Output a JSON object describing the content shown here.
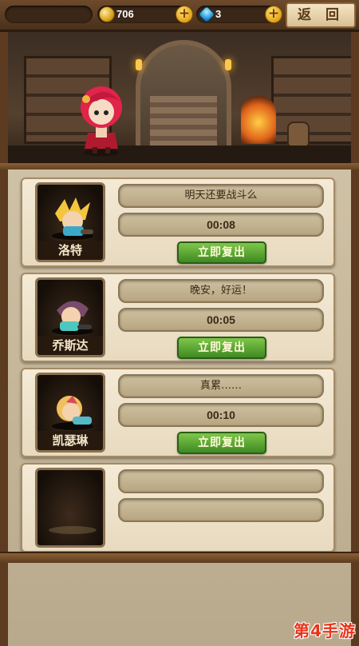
{
  "resources": {
    "gold": "706",
    "gems": "3",
    "plus_symbol": "+"
  },
  "back_button": "返 回",
  "cards": [
    {
      "name": "洛特",
      "message": "明天还要战斗么",
      "timer": "00:08",
      "button": "立即复出"
    },
    {
      "name": "乔斯达",
      "message": "晚安，好运！",
      "timer": "00:05",
      "button": "立即复出"
    },
    {
      "name": "凯瑟琳",
      "message": "真累……",
      "timer": "00:10",
      "button": "立即复出"
    },
    {
      "name": "",
      "message": "",
      "timer": "",
      "button": ""
    }
  ],
  "watermark": "第4手游",
  "colors": {
    "revive_green": "#3e8a22",
    "wood": "#5c3b20",
    "parchment": "#f4ead6"
  },
  "icons": [
    "gold-coin-icon",
    "gem-icon",
    "plus-icon"
  ]
}
